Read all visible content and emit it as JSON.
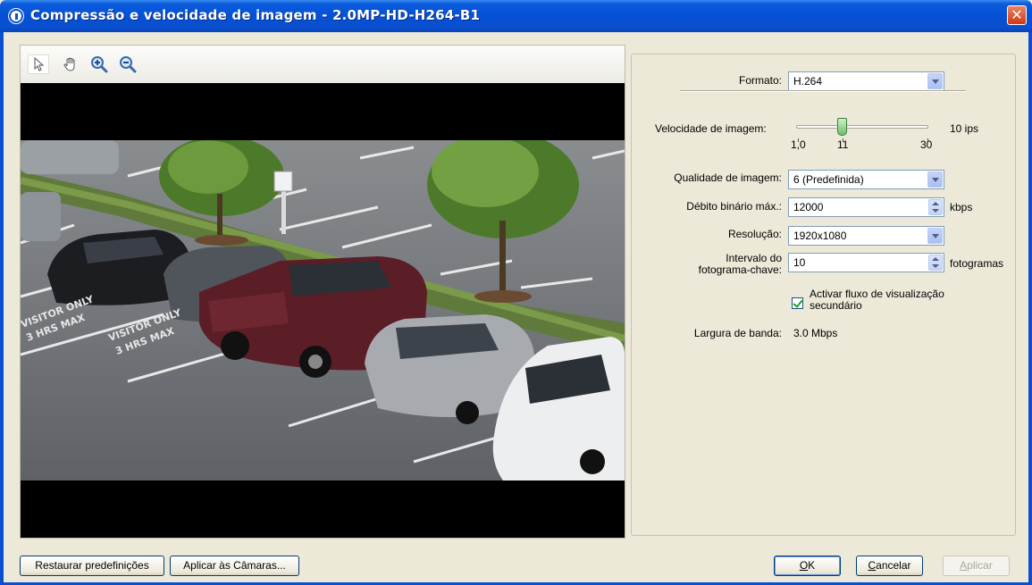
{
  "window": {
    "title": "Compressão e velocidade de imagem - 2.0MP-HD-H264-B1",
    "close_glyph": "✕"
  },
  "toolbar": {
    "tools": [
      "pointer-icon",
      "hand-icon",
      "zoom-in-icon",
      "zoom-out-icon"
    ]
  },
  "settings": {
    "format": {
      "label": "Formato:",
      "value": "H.264"
    },
    "frame_rate": {
      "label": "Velocidade de imagem:",
      "min_label": "1,0",
      "current_label": "11",
      "max_label": "30",
      "readout": "10 ips",
      "min": 1,
      "max": 30,
      "value": 11
    },
    "quality": {
      "label": "Qualidade de imagem:",
      "value": "6 (Predefinida)"
    },
    "max_bitrate": {
      "label": "Débito binário máx.:",
      "value": "12000",
      "unit": "kbps"
    },
    "resolution": {
      "label": "Resolução:",
      "value": "1920x1080"
    },
    "keyframe_interval": {
      "label_line1": "Intervalo do",
      "label_line2": "fotograma-chave:",
      "value": "10",
      "unit": "fotogramas"
    },
    "secondary_stream": {
      "label_line1": "Activar fluxo de visualização",
      "label_line2": "secundário",
      "checked": true
    },
    "bandwidth": {
      "label": "Largura de banda:",
      "value": "3.0 Mbps"
    }
  },
  "buttons": {
    "restore": "Restaurar predefinições",
    "apply_cameras": "Aplicar às Câmaras...",
    "ok_u": "O",
    "ok_rest": "K",
    "cancel_u": "C",
    "cancel_rest": "ancelar",
    "apply_u": "A",
    "apply_rest": "plicar"
  },
  "colors": {
    "titlebar": "#0551d6",
    "window_bg": "#ece9d8",
    "accent_border": "#7f9db9"
  }
}
